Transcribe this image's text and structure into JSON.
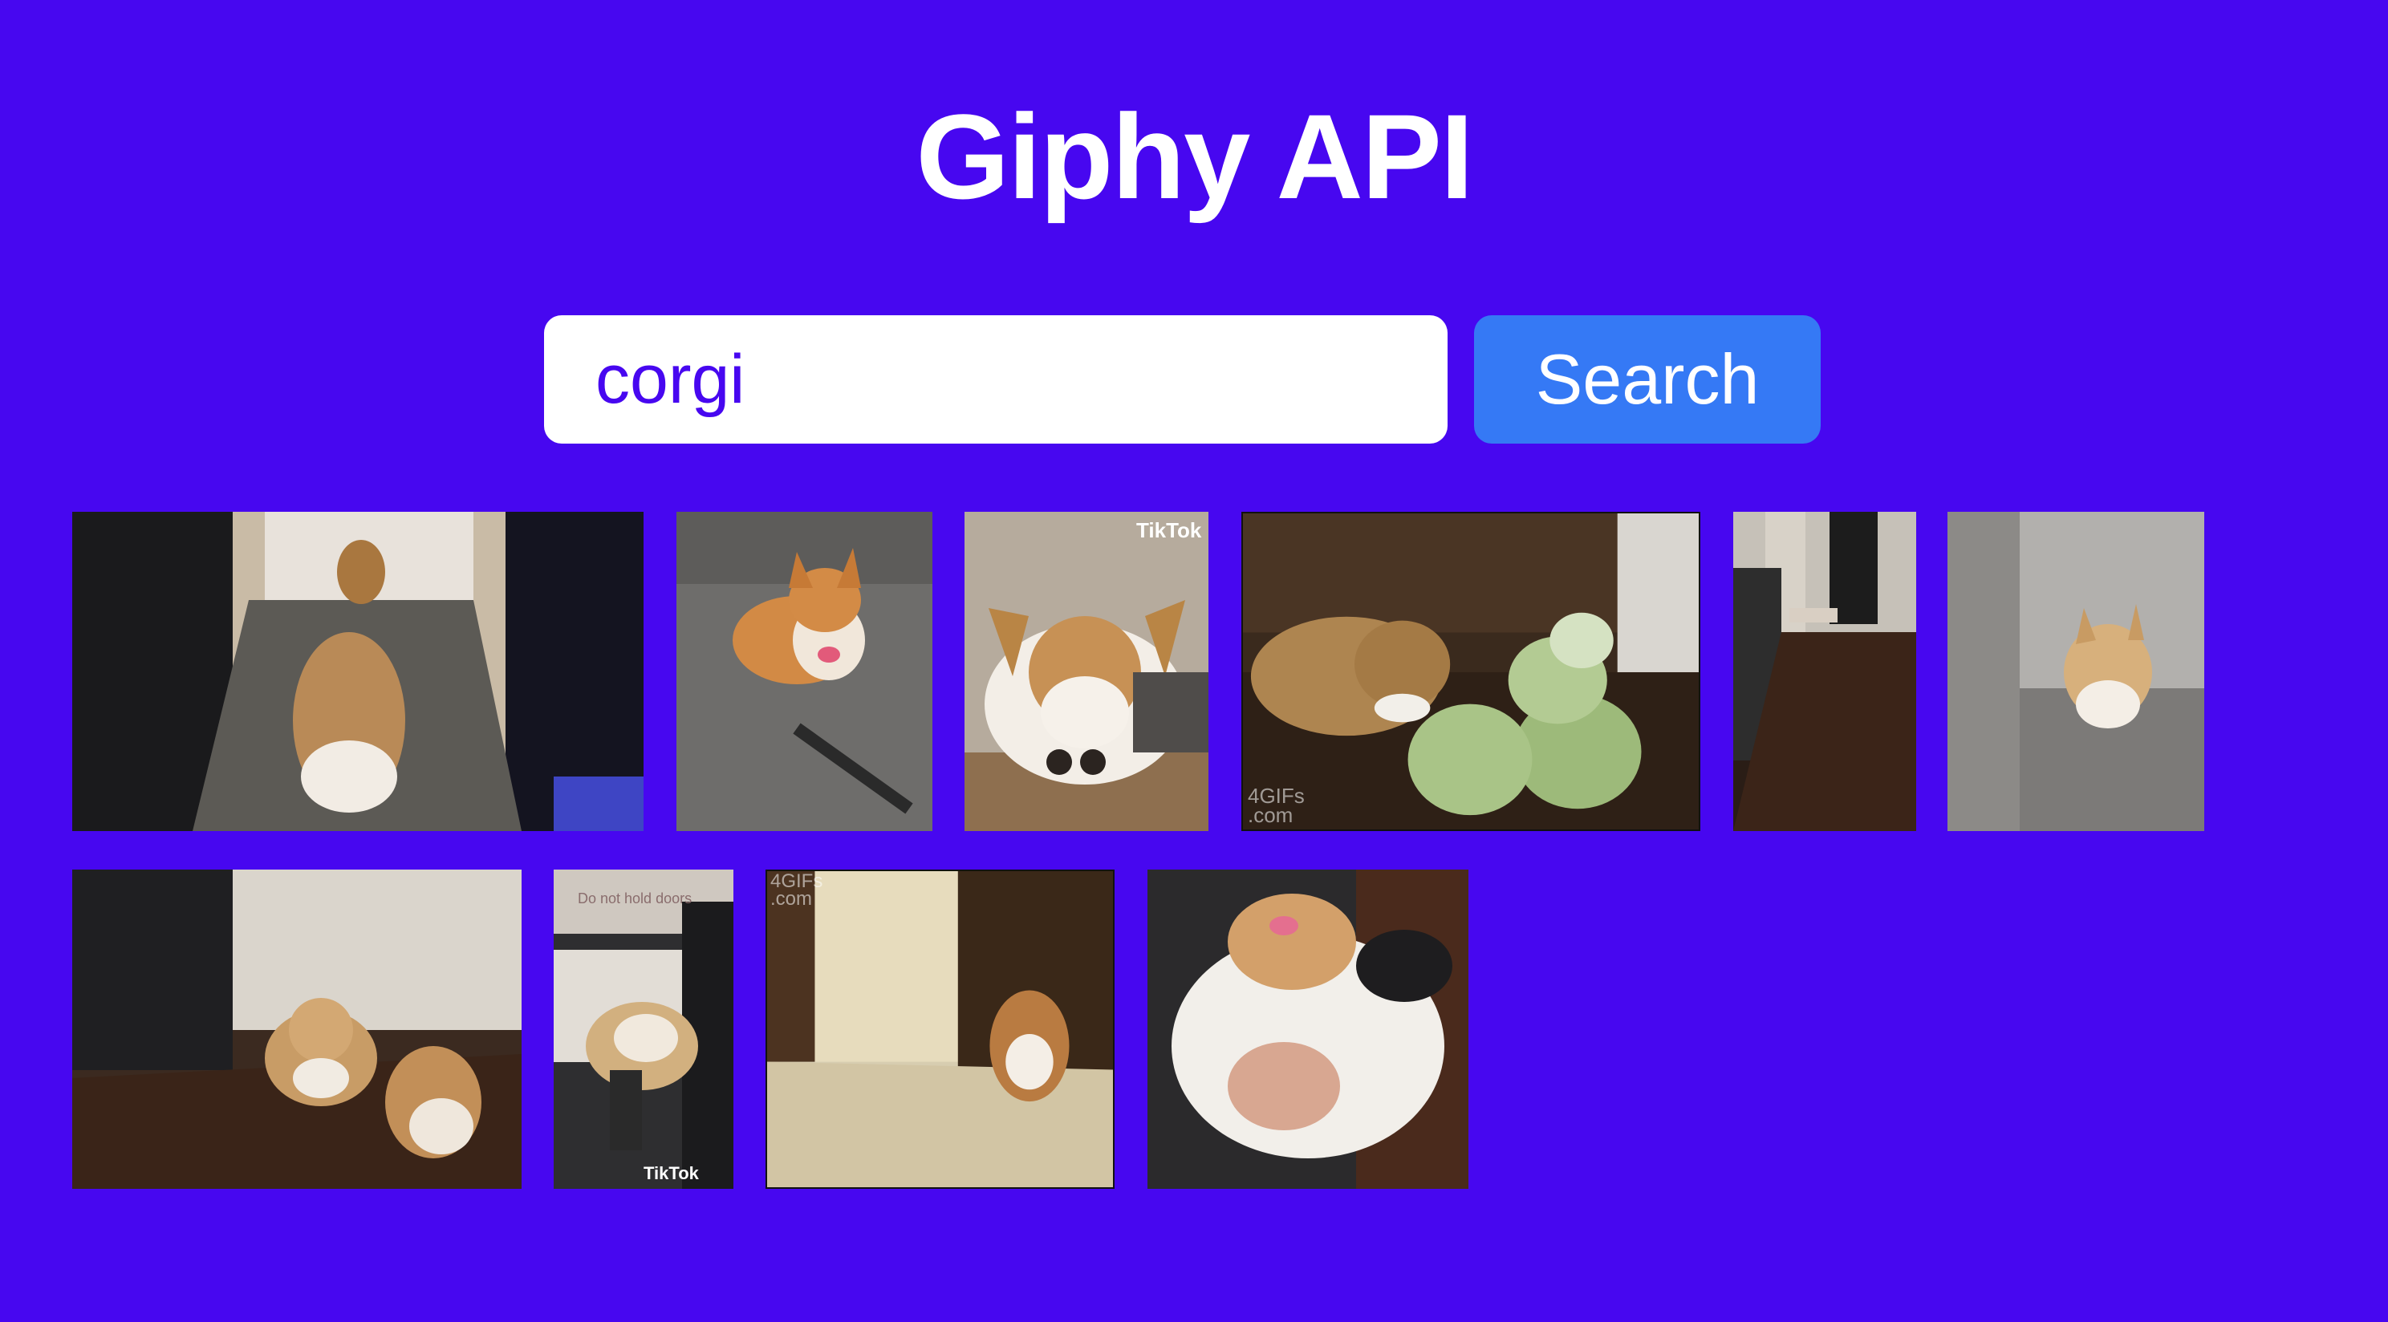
{
  "app": {
    "title": "Giphy API"
  },
  "search": {
    "value": "corgi",
    "button_label": "Search"
  },
  "colors": {
    "background": "#4707f0",
    "button": "#3579f5",
    "input_text": "#4707f0"
  },
  "results": [
    {
      "name": "corgi-walking-hallway-gif"
    },
    {
      "name": "corgi-on-skateboard-gif"
    },
    {
      "name": "corgi-with-sunglasses-gif",
      "watermark": "TikTok"
    },
    {
      "name": "corgi-with-cabbages-gif",
      "watermark": "4GIFs\n.com"
    },
    {
      "name": "corgi-running-hallway-gif"
    },
    {
      "name": "corgi-puppy-on-sofa-gif"
    },
    {
      "name": "corgis-playing-gif"
    },
    {
      "name": "corgi-on-train-gif",
      "watermark": "TikTok",
      "sign": "Do not hold doors"
    },
    {
      "name": "corgi-running-towards-camera-gif",
      "watermark": "4GIFs\n.com"
    },
    {
      "name": "corgi-being-held-gif"
    }
  ]
}
